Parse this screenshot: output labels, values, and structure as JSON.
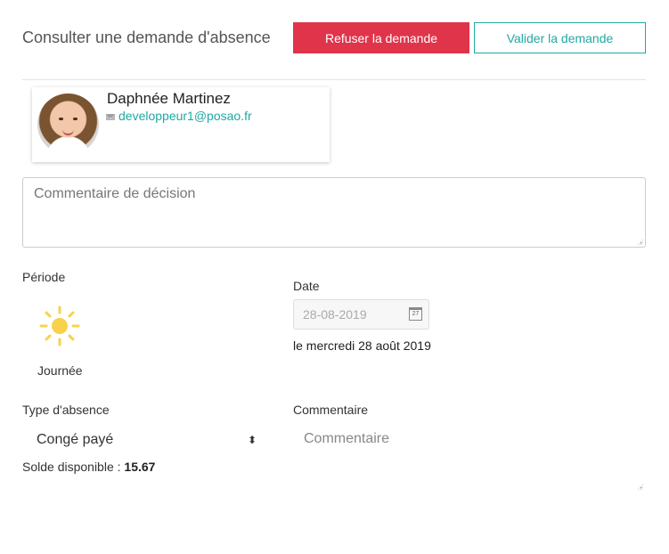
{
  "header": {
    "title": "Consulter une demande d'absence",
    "refuse_label": "Refuser la demande",
    "validate_label": "Valider la demande"
  },
  "employee": {
    "name": "Daphnée Martinez",
    "email": "developpeur1@posao.fr"
  },
  "decision_comment": {
    "placeholder": "Commentaire de décision"
  },
  "period": {
    "label": "Période",
    "value": "Journée",
    "icon": "sun-icon"
  },
  "date": {
    "label": "Date",
    "input_value": "28-08-2019",
    "calendar_day": "27",
    "long_text": "le mercredi 28 août 2019"
  },
  "absence_type": {
    "label": "Type d'absence",
    "selected": "Congé payé",
    "balance_label": "Solde disponible :",
    "balance_value": "15.67"
  },
  "comment": {
    "label": "Commentaire",
    "placeholder": "Commentaire"
  },
  "colors": {
    "refuse": "#e0344a",
    "validate": "#1fa9a2",
    "sun": "#f7d24a"
  }
}
